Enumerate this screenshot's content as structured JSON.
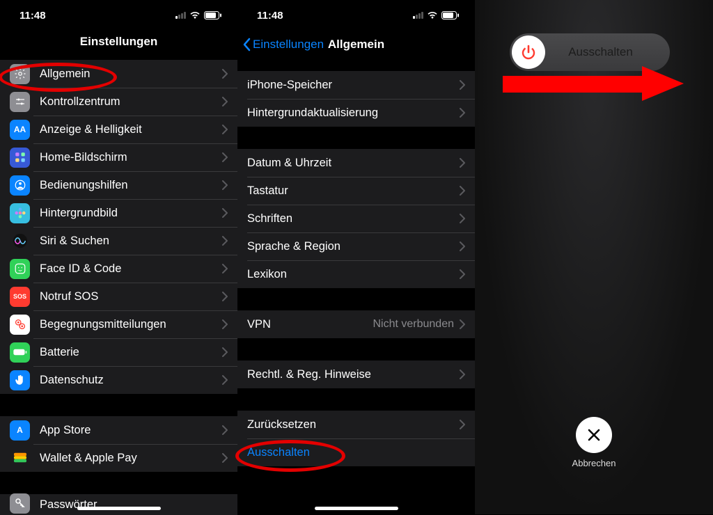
{
  "status": {
    "time": "11:48"
  },
  "phone1": {
    "title": "Einstellungen",
    "items": [
      {
        "id": "general",
        "label": "Allgemein",
        "color": "#8e8e93",
        "icon": "gear"
      },
      {
        "id": "control",
        "label": "Kontrollzentrum",
        "color": "#8e8e93",
        "icon": "sliders"
      },
      {
        "id": "display",
        "label": "Anzeige & Helligkeit",
        "color": "#0a84ff",
        "icon": "AA"
      },
      {
        "id": "home",
        "label": "Home-Bildschirm",
        "color": "#3759d6",
        "icon": "grid"
      },
      {
        "id": "accessibility",
        "label": "Bedienungshilfen",
        "color": "#0a84ff",
        "icon": "person"
      },
      {
        "id": "wallpaper",
        "label": "Hintergrundbild",
        "color": "#37bee0",
        "icon": "flower"
      },
      {
        "id": "siri",
        "label": "Siri & Suchen",
        "color": "#1c1c1e",
        "icon": "siri"
      },
      {
        "id": "faceid",
        "label": "Face ID & Code",
        "color": "#30d158",
        "icon": "face"
      },
      {
        "id": "sos",
        "label": "Notruf SOS",
        "color": "#ff3b30",
        "icon": "SOS"
      },
      {
        "id": "exposure",
        "label": "Begegnungsmitteilungen",
        "color": "#fff",
        "icon": "exposure"
      },
      {
        "id": "battery",
        "label": "Batterie",
        "color": "#30d158",
        "icon": "battery"
      },
      {
        "id": "privacy",
        "label": "Datenschutz",
        "color": "#0a84ff",
        "icon": "hand"
      }
    ],
    "items2": [
      {
        "id": "appstore",
        "label": "App Store",
        "color": "#0a84ff",
        "icon": "A"
      },
      {
        "id": "wallet",
        "label": "Wallet & Apple Pay",
        "color": "#1c1c1e",
        "icon": "wallet"
      }
    ],
    "items3": [
      {
        "id": "passwords",
        "label": "Passwörter",
        "color": "#8e8e93",
        "icon": "key"
      }
    ]
  },
  "phone2": {
    "back": "Einstellungen",
    "title": "Allgemein",
    "g1": [
      {
        "id": "storage",
        "label": "iPhone-Speicher"
      },
      {
        "id": "bg",
        "label": "Hintergrundaktualisierung"
      }
    ],
    "g2": [
      {
        "id": "date",
        "label": "Datum & Uhrzeit"
      },
      {
        "id": "keyboard",
        "label": "Tastatur"
      },
      {
        "id": "fonts",
        "label": "Schriften"
      },
      {
        "id": "lang",
        "label": "Sprache & Region"
      },
      {
        "id": "dict",
        "label": "Lexikon"
      }
    ],
    "g3": [
      {
        "id": "vpn",
        "label": "VPN",
        "detail": "Nicht verbunden"
      }
    ],
    "g4": [
      {
        "id": "legal",
        "label": "Rechtl. & Reg. Hinweise"
      }
    ],
    "g5": [
      {
        "id": "reset",
        "label": "Zurücksetzen"
      },
      {
        "id": "shutdown",
        "label": "Ausschalten",
        "link": true,
        "nochev": true
      }
    ]
  },
  "phone3": {
    "slide_label": "Ausschalten",
    "cancel_label": "Abbrechen"
  }
}
